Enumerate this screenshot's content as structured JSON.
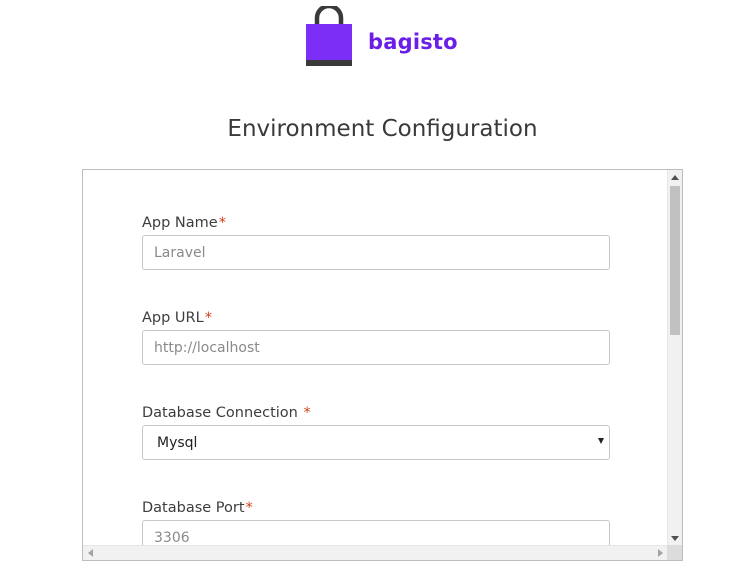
{
  "brand": {
    "name": "bagisto",
    "color": "#6a1ee8",
    "logo_icon": "shopping-bag-icon"
  },
  "page": {
    "title": "Environment Configuration"
  },
  "form": {
    "required_marker": "*",
    "required_color": "#d0421b",
    "app_name": {
      "label": "App Name",
      "placeholder": "Laravel"
    },
    "app_url": {
      "label": "App URL",
      "placeholder": "http://localhost"
    },
    "db_connection": {
      "label": "Database Connection ",
      "selected": "Mysql"
    },
    "db_port": {
      "label": "Database Port",
      "placeholder": "3306"
    }
  }
}
